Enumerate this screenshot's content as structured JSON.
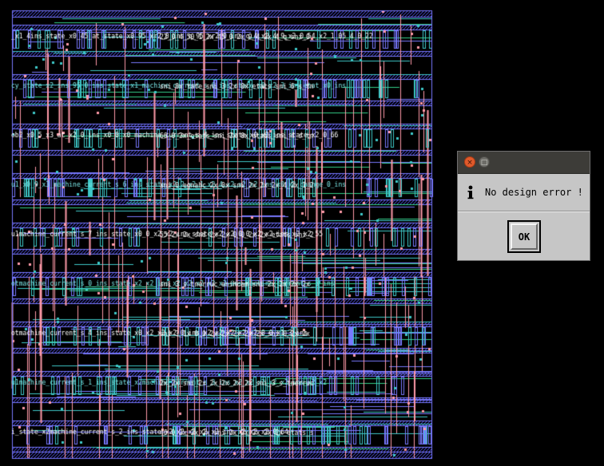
{
  "layout": {
    "colors": {
      "background": "#000000",
      "hatch_blue": "#5a5aff",
      "metal_blue": "#7878ff",
      "metal_cyan": "#3ec8c8",
      "metal_pink": "#ff9aa8",
      "green_wire": "#34d08a",
      "label_white": "#ffffff",
      "label_cyan": "#7be8e8"
    },
    "row_labels": [
      "_x1_4ins_state_x0_45_at_state_x0_95_xr2_0_ins_q_95_xr2_0_ins_q_4_x2_4_9_x2_0_54_x2_1_05_4_0_22",
      "cy_state_x2_ins_95_0_ins_state_x1_machine_current_s_6_ins_state_x0_x2_3_ins_etat_x0_ins",
      "ob2_x0_5_x3_at_x2_0_ins_x0_0_x0_machine_current_s_4_ins_state_x0_x2_ins_state_x2_0_66",
      "u1_x0_9_x3_machine_current_s_6_ins_state_x2_2_x2_1_x2_4_x2_x2_x2_ins_x0_x2_change_0_ins",
      "u1machine_current_s_7_ins_state_x0_0_x2_x2_ins_state_x2_x2_0_0_x2_x2_ins_x2_x2_55",
      "otmachine_current_s_0_ins_state_x2_x2_ins_x2_x2_x2_x2_x2_ins_machine_current_s_3_ins",
      "otmachine_current_s_4_ins_state_x0_x2_x2_x2_0_ins_x2_x2_x2_x2_x2_0_0_x1_3_ins",
      "u1machine_current_s_1_ins_state_x2machine_current_s_3_ins_x2_x2_x2_x2_x2_ins_x2_x2",
      "i_state_x2machine_current_s_2_ins_state_x2_x2_x2_x2_x2_ins_x2_x2_x2_0_64"
    ]
  },
  "dialog": {
    "close_glyph": "×",
    "maximize_glyph": "□",
    "message": "No design error !",
    "ok_label": "OK",
    "icon": "info-icon"
  }
}
